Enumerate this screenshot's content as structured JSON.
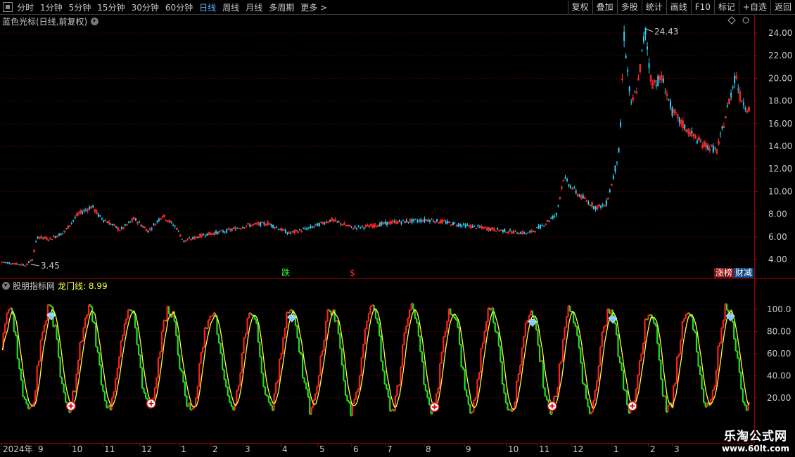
{
  "toolbar": {
    "periods": [
      "分时",
      "1分钟",
      "5分钟",
      "15分钟",
      "30分钟",
      "60分钟",
      "日线",
      "周线",
      "月线",
      "多周期",
      "更多 >"
    ],
    "active_period": "日线",
    "right_buttons": [
      "复权",
      "叠加",
      "多股",
      "统计",
      "画线",
      "F10",
      "标记",
      "+自选",
      "返回"
    ]
  },
  "main_chart": {
    "title": "蓝色光标(日线,前复权)",
    "y_ticks": [
      "24.00",
      "22.00",
      "20.00",
      "18.00",
      "16.00",
      "14.00",
      "12.00",
      "10.00",
      "8.00",
      "6.00",
      "4.00"
    ],
    "max_label": "24.43",
    "min_label": "3.45",
    "mid_markers": [
      "跌",
      "$"
    ],
    "right_markers": [
      "涨榜",
      "财减"
    ]
  },
  "indicator": {
    "title": "股朋指标网",
    "line_label": "龙门线: 8.99",
    "y_ticks": [
      "100.0",
      "80.00",
      "60.00",
      "40.00",
      "20.00"
    ]
  },
  "x_axis": {
    "labels": [
      "2024年",
      "9",
      "10",
      "11",
      "12",
      "1",
      "2",
      "3",
      "4",
      "5",
      "6",
      "7",
      "8",
      "9",
      "10",
      "11",
      "12",
      "1",
      "2",
      "3"
    ]
  },
  "watermark": {
    "line1": "乐淘公式网",
    "line2": "www.60lt.com"
  },
  "colors": {
    "up": "#ff2a2a",
    "down": "#2bd6ff",
    "ind_up": "#ff2020",
    "ind_down": "#20e020",
    "yellow_line": "#ffff40",
    "grid": "#7a0000",
    "axis_text": "#c8c8c8",
    "active": "#5ab0ff"
  },
  "icons": {
    "buy": "red-cross-circle-icon",
    "sell": "blue-diamond-icon"
  }
}
